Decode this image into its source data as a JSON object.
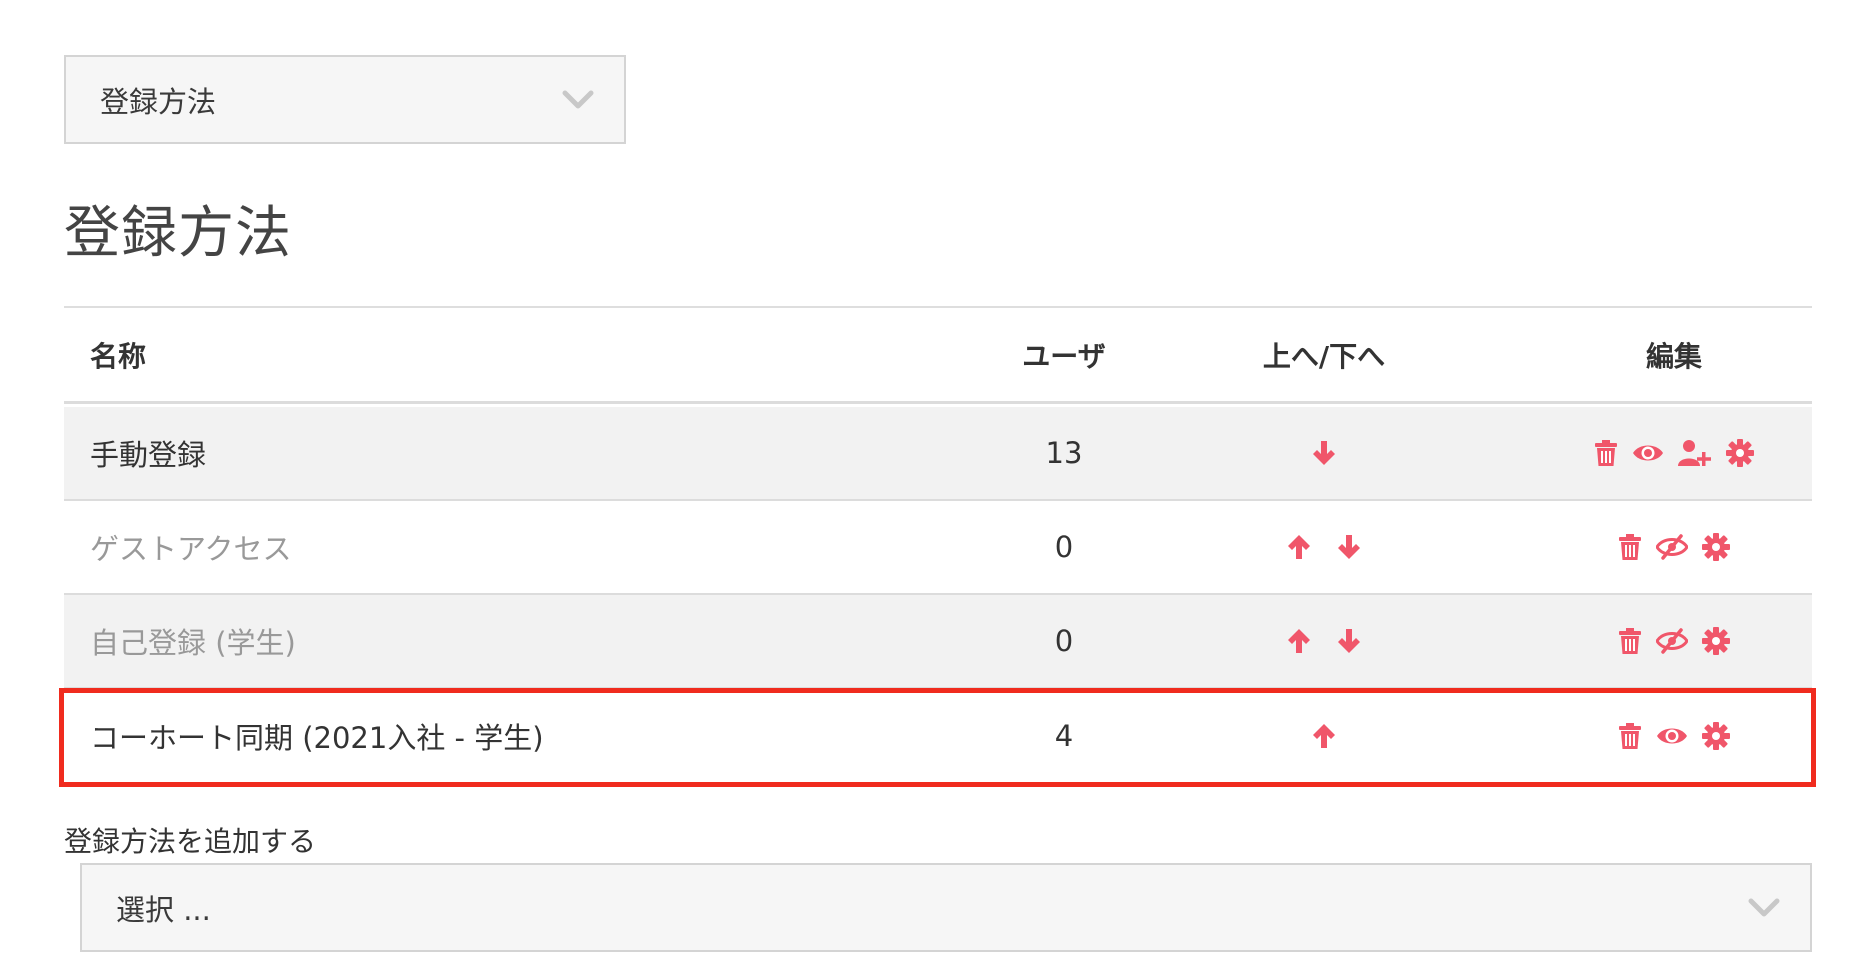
{
  "nav_select": {
    "value": "登録方法"
  },
  "page_title": "登録方法",
  "table": {
    "headers": {
      "name": "名称",
      "users": "ユーザ",
      "updown": "上へ/下へ",
      "edit": "編集"
    },
    "rows": [
      {
        "name": "手動登録",
        "users": "13",
        "dimmed": false,
        "up": false,
        "down": true,
        "edit_icons": [
          "trash-icon",
          "eye-icon",
          "enrol-user-icon",
          "gear-icon"
        ]
      },
      {
        "name": "ゲストアクセス",
        "users": "0",
        "dimmed": true,
        "up": true,
        "down": true,
        "edit_icons": [
          "trash-icon",
          "eye-slash-icon",
          "gear-icon"
        ]
      },
      {
        "name": "自己登録 (学生)",
        "users": "0",
        "dimmed": true,
        "up": true,
        "down": true,
        "edit_icons": [
          "trash-icon",
          "eye-slash-icon",
          "gear-icon"
        ]
      },
      {
        "name": "コーホート同期 (2021入社 - 学生)",
        "users": "4",
        "dimmed": false,
        "up": true,
        "down": false,
        "edit_icons": [
          "trash-icon",
          "eye-icon",
          "gear-icon"
        ],
        "highlighted": true
      }
    ]
  },
  "add_method": {
    "label": "登録方法を追加する",
    "value": "選択 ..."
  },
  "colors": {
    "icon_accent": "#f0566a",
    "highlight": "#f02b1e"
  }
}
